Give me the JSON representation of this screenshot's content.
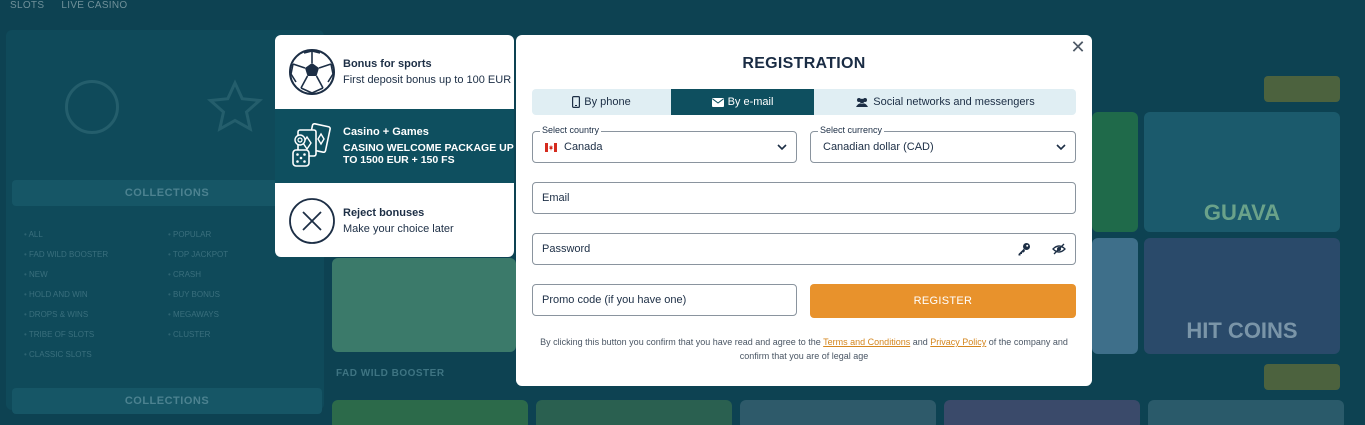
{
  "background": {
    "nav": [
      "SLOTS",
      "LIVE CASINO"
    ],
    "collections_label": "COLLECTIONS",
    "left_list": [
      "ALL",
      "FAD WILD BOOSTER",
      "NEW",
      "HOLD AND WIN",
      "DROPS & WINS",
      "TRIBE OF SLOTS",
      "CLASSIC SLOTS"
    ],
    "right_list": [
      "POPULAR",
      "TOP JACKPOT",
      "CRASH",
      "BUY BONUS",
      "MEGAWAYS",
      "CLUSTER"
    ],
    "section_title": "FAD WILD BOOSTER",
    "tile_labels": [
      "GUAVA",
      "HIT COINS"
    ]
  },
  "bonus_options": {
    "sports": {
      "title": "Bonus for sports",
      "description": "First deposit bonus up to 100 EUR",
      "icon": "soccer-ball-icon"
    },
    "casino": {
      "title": "Casino + Games",
      "description": "CASINO WELCOME PACKAGE UP TO 1500 EUR + 150 FS",
      "icon": "cards-dice-icon"
    },
    "reject": {
      "title": "Reject bonuses",
      "description": "Make your choice later",
      "icon": "close-circle-icon"
    }
  },
  "registration": {
    "title": "REGISTRATION",
    "close_icon": "close-icon",
    "tabs": [
      {
        "label": "By phone",
        "icon": "phone-icon",
        "active": false
      },
      {
        "label": "By e-mail",
        "icon": "envelope-icon",
        "active": true
      },
      {
        "label": "Social networks and messengers",
        "icon": "users-icon",
        "active": false
      }
    ],
    "country": {
      "label": "Select country",
      "value": "Canada",
      "flag": "canada-flag-icon"
    },
    "currency": {
      "label": "Select currency",
      "value": "Canadian dollar (CAD)"
    },
    "email": {
      "placeholder": "Email"
    },
    "password": {
      "placeholder": "Password"
    },
    "promo": {
      "placeholder": "Promo code (if you have one)"
    },
    "register_label": "REGISTER",
    "terms": {
      "prefix": "By clicking this button you confirm that you have read and agree to the",
      "terms_link": "Terms and Conditions",
      "and": "and",
      "privacy_link": "Privacy Policy",
      "suffix": "of the company and confirm that you are of legal age"
    }
  },
  "colors": {
    "accent": "#e8922c",
    "primary": "#0e4f5f",
    "backdrop": "#0d4252"
  }
}
